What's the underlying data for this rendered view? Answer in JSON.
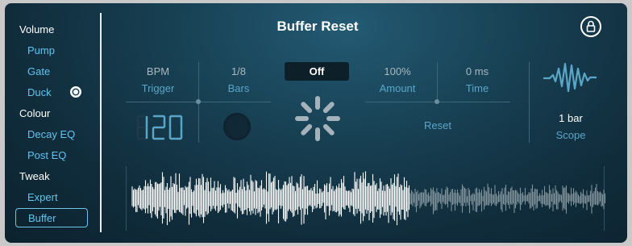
{
  "window": {
    "title": "Buffer Reset"
  },
  "sidebar": {
    "items": [
      {
        "label": "Volume",
        "kind": "header"
      },
      {
        "label": "Pump",
        "kind": "sub"
      },
      {
        "label": "Gate",
        "kind": "sub"
      },
      {
        "label": "Duck",
        "kind": "sub",
        "indicator": "radio-filled"
      },
      {
        "label": "Colour",
        "kind": "header"
      },
      {
        "label": "Decay EQ",
        "kind": "sub"
      },
      {
        "label": "Post EQ",
        "kind": "sub"
      },
      {
        "label": "Tweak",
        "kind": "header"
      },
      {
        "label": "Expert",
        "kind": "sub"
      },
      {
        "label": "Buffer",
        "kind": "sub",
        "selected": true
      }
    ]
  },
  "params": {
    "trigger": {
      "value": "BPM",
      "label": "Trigger",
      "display": "120"
    },
    "bars": {
      "value": "1/8",
      "label": "Bars"
    },
    "toggle": {
      "value": "Off"
    },
    "amount": {
      "value": "100%",
      "label": "Amount"
    },
    "time": {
      "value": "0 ms",
      "label": "Time"
    },
    "reset": {
      "label": "Reset"
    },
    "scope": {
      "value": "1 bar",
      "label": "Scope"
    }
  },
  "icons": {
    "lock": "lock-icon",
    "spinner": "loading-spinner-icon",
    "scope": "waveform-icon"
  },
  "colors": {
    "accent": "#5aa6c8",
    "bg": "#173f52",
    "text": "#ffffff"
  }
}
